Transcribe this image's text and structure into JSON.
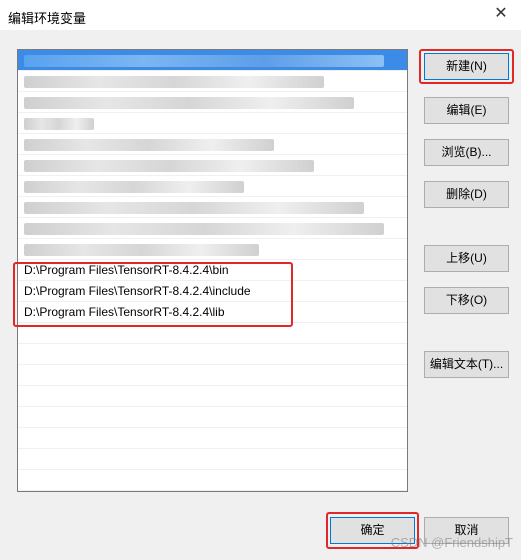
{
  "window": {
    "title": "编辑环境变量",
    "close_glyph": "✕"
  },
  "list": {
    "visible_entries": [
      "D:\\Program Files\\TensorRT-8.4.2.4\\bin",
      "D:\\Program Files\\TensorRT-8.4.2.4\\include",
      "D:\\Program Files\\TensorRT-8.4.2.4\\lib"
    ]
  },
  "buttons": {
    "new": "新建(N)",
    "edit": "编辑(E)",
    "browse": "浏览(B)...",
    "delete": "删除(D)",
    "move_up": "上移(U)",
    "move_down": "下移(O)",
    "edit_text": "编辑文本(T)...",
    "ok": "确定",
    "cancel": "取消"
  },
  "watermark": "CSDN @FriendshipT",
  "colors": {
    "selection": "#3c8ce7",
    "highlight_box": "#e02828"
  }
}
